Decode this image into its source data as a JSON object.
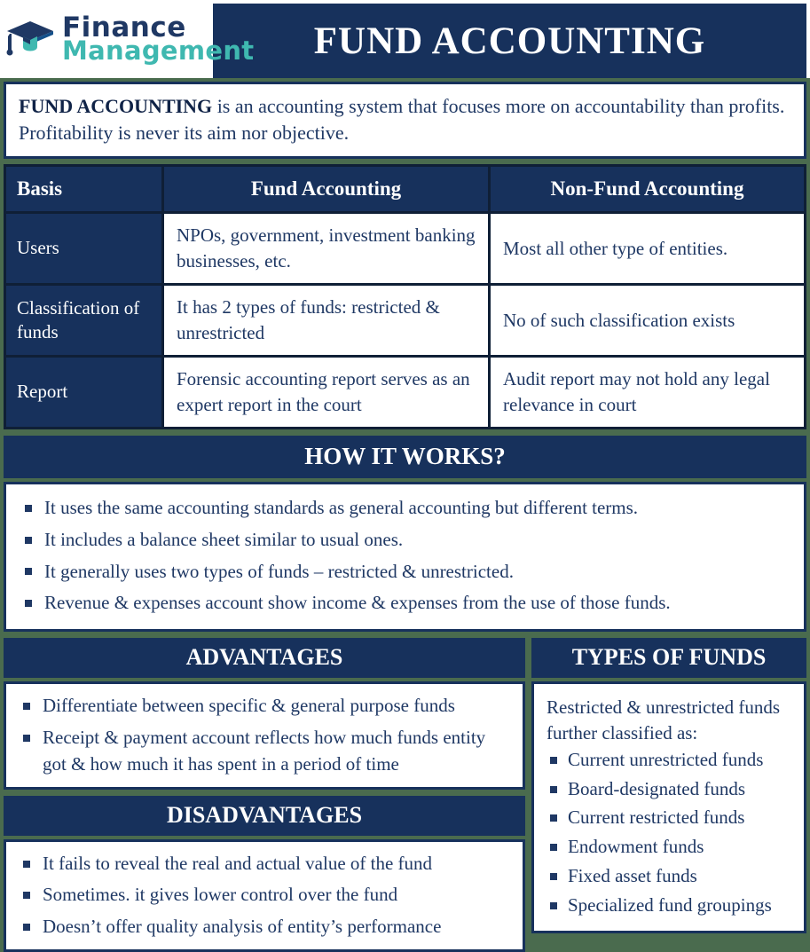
{
  "header": {
    "logo": {
      "icon": "graduation-cap-icon",
      "line1": "Finance",
      "line2": "Management",
      "color_navy": "#1f3864",
      "color_teal": "#3fb8b0"
    },
    "title": "FUND ACCOUNTING"
  },
  "definition": {
    "lead": "FUND ACCOUNTING",
    "rest": " is an accounting system that focuses more on accountability than profits. Profitability is never its aim nor objective."
  },
  "comparison_table": {
    "headers": [
      "Basis",
      "Fund Accounting",
      "Non-Fund Accounting"
    ],
    "rows": [
      {
        "basis": "Users",
        "fund": "NPOs, government, investment banking businesses, etc.",
        "nonfund": "Most all other type of entities."
      },
      {
        "basis": "Classification of funds",
        "fund": "It has 2 types of funds: restricted & unrestricted",
        "nonfund": "No of such classification exists"
      },
      {
        "basis": "Report",
        "fund": "Forensic accounting report serves as an expert report in the court",
        "nonfund": "Audit report may not hold any legal relevance in court"
      }
    ]
  },
  "how_it_works": {
    "title": "HOW IT WORKS?",
    "items": [
      "It uses the same accounting standards as general accounting but different terms.",
      "It includes a balance sheet similar to usual ones.",
      "It generally uses two types of funds – restricted & unrestricted.",
      "Revenue & expenses account show income & expenses from the use of those funds."
    ]
  },
  "advantages": {
    "title": "ADVANTAGES",
    "items": [
      "Differentiate between specific & general purpose funds",
      "Receipt & payment account reflects how much funds entity got & how much it has spent in a period of time"
    ]
  },
  "disadvantages": {
    "title": "DISADVANTAGES",
    "items": [
      "It fails to reveal the real and actual value of the fund",
      "Sometimes. it gives lower control over the fund",
      "Doesn’t offer quality analysis of entity’s performance"
    ]
  },
  "types_of_funds": {
    "title": "TYPES OF FUNDS",
    "intro": "Restricted & unrestricted funds further classified as:",
    "items": [
      "Current unrestricted funds",
      "Board-designated funds",
      "Current restricted funds",
      "Endowment funds",
      "Fixed asset funds",
      "Specialized fund groupings"
    ]
  },
  "colors": {
    "navy": "#17315c",
    "navy_text": "#1f3864",
    "green_background": "#4a6b4e",
    "white": "#ffffff"
  }
}
